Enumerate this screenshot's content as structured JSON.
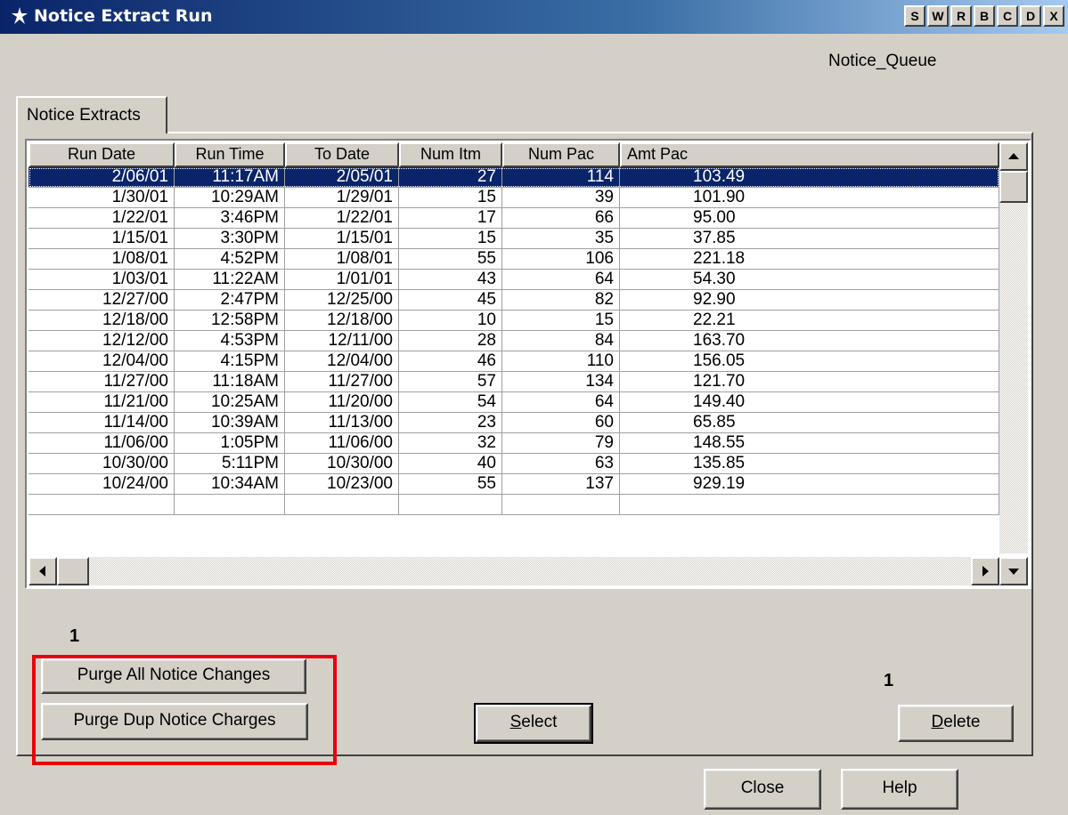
{
  "window": {
    "title": "Notice Extract Run",
    "title_buttons": [
      "S",
      "W",
      "R",
      "B",
      "C",
      "D",
      "X"
    ],
    "queue_label": "Notice_Queue"
  },
  "tab": {
    "label": "Notice Extracts"
  },
  "grid": {
    "columns": [
      "Run Date",
      "Run Time",
      "To Date",
      "Num Itm",
      "Num Pac",
      "Amt Pac"
    ],
    "rows": [
      [
        "2/06/01",
        "11:17AM",
        "2/05/01",
        "27",
        "114",
        "103.49"
      ],
      [
        "1/30/01",
        "10:29AM",
        "1/29/01",
        "15",
        "39",
        "101.90"
      ],
      [
        "1/22/01",
        "3:46PM",
        "1/22/01",
        "17",
        "66",
        "95.00"
      ],
      [
        "1/15/01",
        "3:30PM",
        "1/15/01",
        "15",
        "35",
        "37.85"
      ],
      [
        "1/08/01",
        "4:52PM",
        "1/08/01",
        "55",
        "106",
        "221.18"
      ],
      [
        "1/03/01",
        "11:22AM",
        "1/01/01",
        "43",
        "64",
        "54.30"
      ],
      [
        "12/27/00",
        "2:47PM",
        "12/25/00",
        "45",
        "82",
        "92.90"
      ],
      [
        "12/18/00",
        "12:58PM",
        "12/18/00",
        "10",
        "15",
        "22.21"
      ],
      [
        "12/12/00",
        "4:53PM",
        "12/11/00",
        "28",
        "84",
        "163.70"
      ],
      [
        "12/04/00",
        "4:15PM",
        "12/04/00",
        "46",
        "110",
        "156.05"
      ],
      [
        "11/27/00",
        "11:18AM",
        "11/27/00",
        "57",
        "134",
        "121.70"
      ],
      [
        "11/21/00",
        "10:25AM",
        "11/20/00",
        "54",
        "64",
        "149.40"
      ],
      [
        "11/14/00",
        "10:39AM",
        "11/13/00",
        "23",
        "60",
        "65.85"
      ],
      [
        "11/06/00",
        "1:05PM",
        "11/06/00",
        "32",
        "79",
        "148.55"
      ],
      [
        "10/30/00",
        "5:11PM",
        "10/30/00",
        "40",
        "63",
        "135.85"
      ],
      [
        "10/24/00",
        "10:34AM",
        "10/23/00",
        "55",
        "137",
        "929.19"
      ]
    ],
    "selected_row": 0
  },
  "labels": {
    "count_left": "1",
    "count_right": "1"
  },
  "buttons": {
    "purge_all": "Purge All Notice Changes",
    "purge_dup": "Purge Dup Notice Charges",
    "select_prefix": "S",
    "select_rest": "elect",
    "delete_prefix": "D",
    "delete_rest": "elete",
    "close": "Close",
    "help": "Help"
  },
  "colors": {
    "selection": "#0a246a",
    "annotation": "#e8000b",
    "face": "#d4d0c8"
  }
}
